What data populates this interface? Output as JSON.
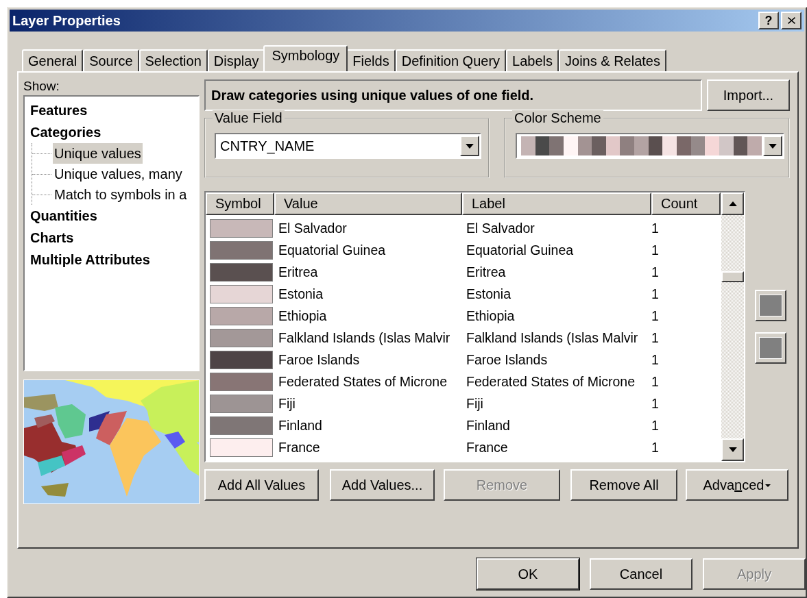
{
  "window": {
    "title": "Layer Properties",
    "title_buttons": [
      {
        "kind": "help",
        "label": "?"
      },
      {
        "kind": "close"
      }
    ]
  },
  "tabs": [
    {
      "label": "General",
      "selected": false
    },
    {
      "label": "Source",
      "selected": false
    },
    {
      "label": "Selection",
      "selected": false
    },
    {
      "label": "Display",
      "selected": false
    },
    {
      "label": "Symbology",
      "selected": true
    },
    {
      "label": "Fields",
      "selected": false
    },
    {
      "label": "Definition Query",
      "selected": false
    },
    {
      "label": "Labels",
      "selected": false
    },
    {
      "label": "Joins & Relates",
      "selected": false
    }
  ],
  "show": {
    "label": "Show:",
    "items": [
      {
        "label": "Features",
        "selected": false
      },
      {
        "label": "Categories",
        "selected": false,
        "children": [
          {
            "label": "Unique values",
            "selected": true
          },
          {
            "label": "Unique values, many",
            "selected": false
          },
          {
            "label": "Match to symbols in a",
            "selected": false
          }
        ]
      },
      {
        "label": "Quantities",
        "selected": false
      },
      {
        "label": "Charts",
        "selected": false
      },
      {
        "label": "Multiple Attributes",
        "selected": false
      }
    ]
  },
  "description": "Draw categories using unique values of one field.",
  "import_button": "Import...",
  "value_field": {
    "label": "Value Field",
    "value": "CNTRY_NAME"
  },
  "color_scheme": {
    "label": "Color Scheme",
    "swatches": [
      {
        "color": "#c4b4b4"
      },
      {
        "color": "#4a4a4a"
      },
      {
        "color": "#7f7373"
      },
      {
        "color": "#fff5f5"
      },
      {
        "color": "#a39393"
      },
      {
        "color": "#6b5f5f"
      },
      {
        "color": "#e2c8c8"
      },
      {
        "color": "#8f8080"
      },
      {
        "color": "#b3a3a3"
      },
      {
        "color": "#5a4f4f"
      },
      {
        "color": "#f5e3e3"
      },
      {
        "color": "#7a6868"
      },
      {
        "color": "#958a8a"
      },
      {
        "color": "#f5d7d7"
      },
      {
        "color": "#d1c6c6"
      },
      {
        "color": "#615656"
      },
      {
        "color": "#bfabab"
      }
    ]
  },
  "table": {
    "columns": [
      "Symbol",
      "Value",
      "Label",
      "Count"
    ],
    "rows": [
      {
        "color": "#c8b8b8",
        "value": "El Salvador",
        "label": "El Salvador",
        "count": "1"
      },
      {
        "color": "#7f7373",
        "value": "Equatorial Guinea",
        "label": "Equatorial Guinea",
        "count": "1"
      },
      {
        "color": "#5a5050",
        "value": "Eritrea",
        "label": "Eritrea",
        "count": "1"
      },
      {
        "color": "#e6d6d6",
        "value": "Estonia",
        "label": "Estonia",
        "count": "1"
      },
      {
        "color": "#b8a8a8",
        "value": "Ethiopia",
        "label": "Ethiopia",
        "count": "1"
      },
      {
        "color": "#a39898",
        "value": "Falkland Islands (Islas Malvir",
        "label": "Falkland Islands (Islas Malvir",
        "count": "1"
      },
      {
        "color": "#4e4446",
        "value": "Faroe Islands",
        "label": "Faroe Islands",
        "count": "1"
      },
      {
        "color": "#887575",
        "value": "Federated States of Microne",
        "label": "Federated States of Microne",
        "count": "1"
      },
      {
        "color": "#9d9494",
        "value": "Fiji",
        "label": "Fiji",
        "count": "1"
      },
      {
        "color": "#7f7676",
        "value": "Finland",
        "label": "Finland",
        "count": "1"
      },
      {
        "color": "#fdeeee",
        "value": "France",
        "label": "France",
        "count": "1"
      }
    ]
  },
  "table_buttons": [
    {
      "label": "Add All Values",
      "disabled": false
    },
    {
      "label": "Add Values...",
      "disabled": false
    },
    {
      "label": "Remove",
      "disabled": true
    },
    {
      "label": "Remove All",
      "disabled": false
    },
    {
      "label": "Adva",
      "access_key": "n",
      "label_after": "ced",
      "disabled": false,
      "menu": true
    }
  ],
  "footer_buttons": [
    {
      "label": "OK",
      "disabled": false,
      "default": true
    },
    {
      "label": "Cancel",
      "disabled": false,
      "default": false
    },
    {
      "label": "Apply",
      "disabled": true,
      "default": false
    }
  ]
}
